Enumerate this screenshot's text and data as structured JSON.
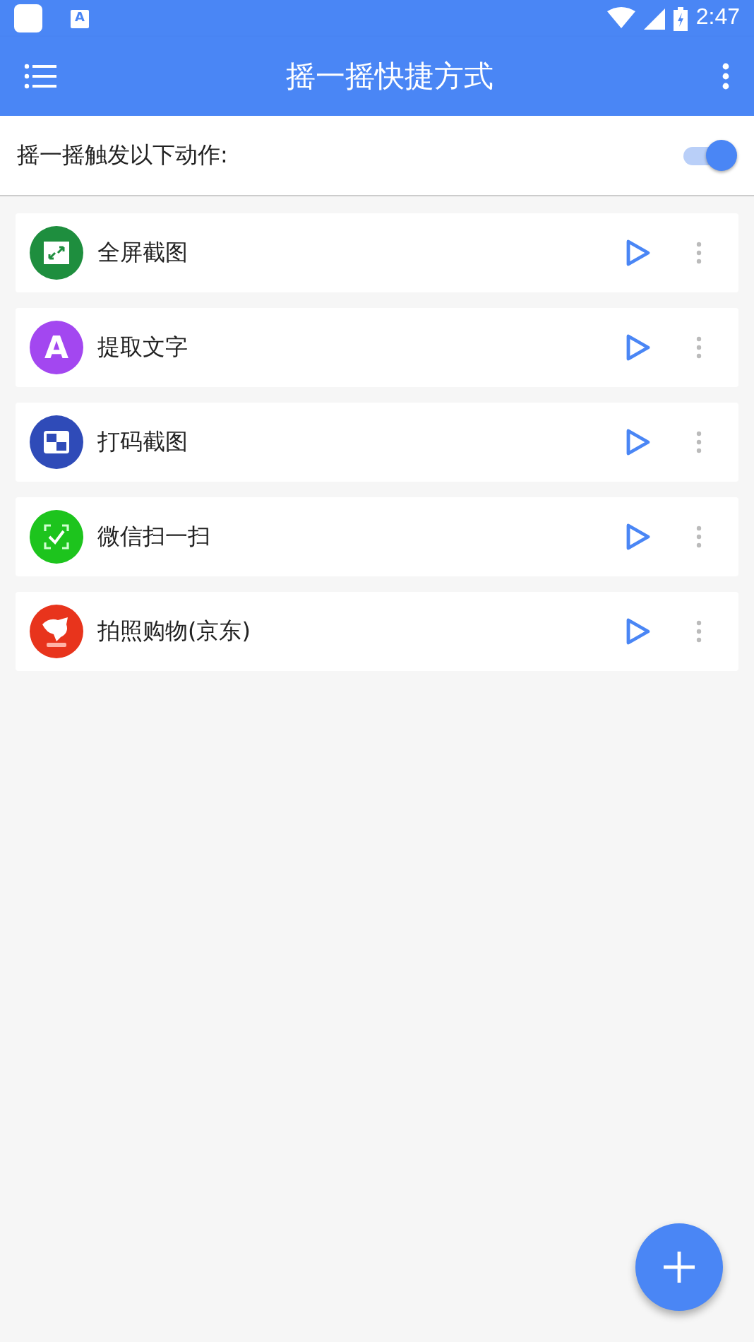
{
  "status_bar": {
    "notification_badge": "A",
    "time": "2:47"
  },
  "app_bar": {
    "title": "摇一摇快捷方式"
  },
  "shake_toggle": {
    "label": "摇一摇触发以下动作:",
    "on": true
  },
  "actions": [
    {
      "label": "全屏截图",
      "kind": "expand",
      "color": "#1e8e3e"
    },
    {
      "label": "提取文字",
      "kind": "letter",
      "letter": "A",
      "color": "#a347f0"
    },
    {
      "label": "打码截图",
      "kind": "mosaic",
      "color": "#2f4bb8"
    },
    {
      "label": "微信扫一扫",
      "kind": "scan",
      "color": "#1dc41d"
    },
    {
      "label": "拍照购物(京东)",
      "kind": "dog",
      "color": "#e8341c"
    }
  ]
}
